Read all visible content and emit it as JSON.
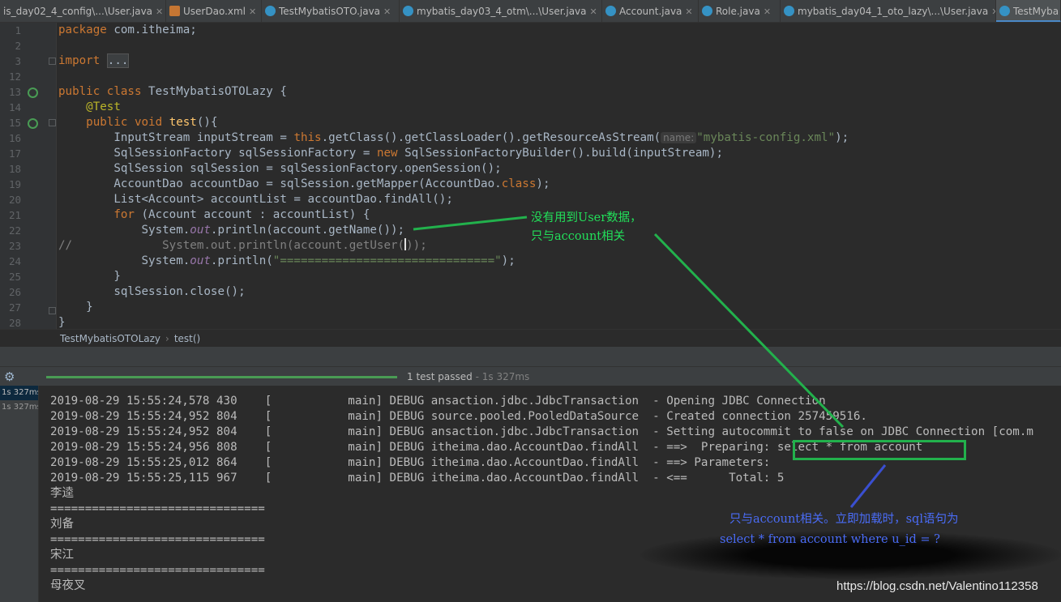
{
  "tabs": [
    {
      "label": "is_day02_4_config\\...\\User.java",
      "icon": "java-class-icon"
    },
    {
      "label": "UserDao.xml",
      "icon": "xml-file-icon"
    },
    {
      "label": "TestMybatisOTO.java",
      "icon": "java-class-icon"
    },
    {
      "label": "mybatis_day03_4_otm\\...\\User.java",
      "icon": "java-class-icon"
    },
    {
      "label": "Account.java",
      "icon": "java-class-icon"
    },
    {
      "label": "Role.java",
      "icon": "java-class-icon"
    },
    {
      "label": "mybatis_day04_1_oto_lazy\\...\\User.java",
      "icon": "java-class-icon"
    },
    {
      "label": "TestMyba",
      "icon": "java-class-icon"
    }
  ],
  "editor": {
    "line_numbers": [
      "1",
      "2",
      "3",
      "12",
      "13",
      "14",
      "15",
      "16",
      "17",
      "18",
      "19",
      "20",
      "21",
      "22",
      "23",
      "24",
      "25",
      "26",
      "27",
      "28"
    ],
    "code": {
      "l1_kw": "package",
      "l1_rest": " com.itheima;",
      "l3_kw": "import",
      "l3_fold": "...",
      "l13_kw": "public class",
      "l13_rest": " TestMybatisOTOLazy {",
      "l14_ann": "@Test",
      "l15_kw": "public void",
      "l15_fn": "test",
      "l15_rest": "(){",
      "l16_a": "InputStream inputStream = ",
      "l16_kw": "this",
      "l16_b": ".getClass().getClassLoader().getResourceAsStream(",
      "l16_hint": "name:",
      "l16_str": "\"mybatis-config.xml\"",
      "l16_c": ");",
      "l17_a": "SqlSessionFactory sqlSessionFactory = ",
      "l17_kw": "new",
      "l17_b": " SqlSessionFactoryBuilder().build(inputStream);",
      "l18": "SqlSession sqlSession = sqlSessionFactory.openSession();",
      "l19_a": "AccountDao accountDao = sqlSession.getMapper(AccountDao.",
      "l19_kw": "class",
      "l19_b": ");",
      "l20": "List<Account> accountList = accountDao.findAll();",
      "l21_kw": "for",
      "l21_rest": " (Account account : accountList) {",
      "l22_a": "System.",
      "l22_out": "out",
      "l22_b": ".println(account.getName());",
      "l23_comment": "//",
      "l23_a": "System.out.println(account.getUser(",
      "l23_b": ");",
      "l24_a": "System.",
      "l24_out": "out",
      "l24_b": ".println(",
      "l24_str": "\"===============================\"",
      "l24_c": ");",
      "l25": "}",
      "l26": "sqlSession.close();",
      "l27": "}",
      "l28": "}"
    }
  },
  "breadcrumb": {
    "class_name": "TestMybatisOTOLazy",
    "method": "test()",
    "separator": "›"
  },
  "run": {
    "status": "1 test passed",
    "time": " - 1s 327ms",
    "progress": 1.0
  },
  "test_tree": [
    "1s 327ms",
    "1s 327ms"
  ],
  "console": {
    "lines": [
      "2019-08-29 15:55:24,578 430    [           main] DEBUG ansaction.jdbc.JdbcTransaction  - Opening JDBC Connection",
      "2019-08-29 15:55:24,952 804    [           main] DEBUG source.pooled.PooledDataSource  - Created connection 257459516.",
      "2019-08-29 15:55:24,952 804    [           main] DEBUG ansaction.jdbc.JdbcTransaction  - Setting autocommit to false on JDBC Connection [com.m",
      "2019-08-29 15:55:24,956 808    [           main] DEBUG itheima.dao.AccountDao.findAll  - ==>  Preparing: select * from account",
      "2019-08-29 15:55:25,012 864    [           main] DEBUG itheima.dao.AccountDao.findAll  - ==> Parameters: ",
      "2019-08-29 15:55:25,115 967    [           main] DEBUG itheima.dao.AccountDao.findAll  - <==      Total: 5"
    ],
    "outputs": [
      "李逵",
      "===============================",
      "刘备",
      "===============================",
      "宋江",
      "===============================",
      "母夜叉"
    ]
  },
  "annotations": {
    "green_line1": "没有用到User数据，",
    "green_line2": "只与account相关",
    "blue_line1": "只与account相关。立即加载时，sql语句为",
    "blue_line2": "select * from account where u_id = ?"
  },
  "watermark": "https://blog.csdn.net/Valentino112358",
  "colors": {
    "keyword": "#cc7832",
    "string": "#6a8759",
    "annotation_green": "#22b14c",
    "annotation_blue": "#4a6cf7",
    "progress": "#499c54"
  }
}
